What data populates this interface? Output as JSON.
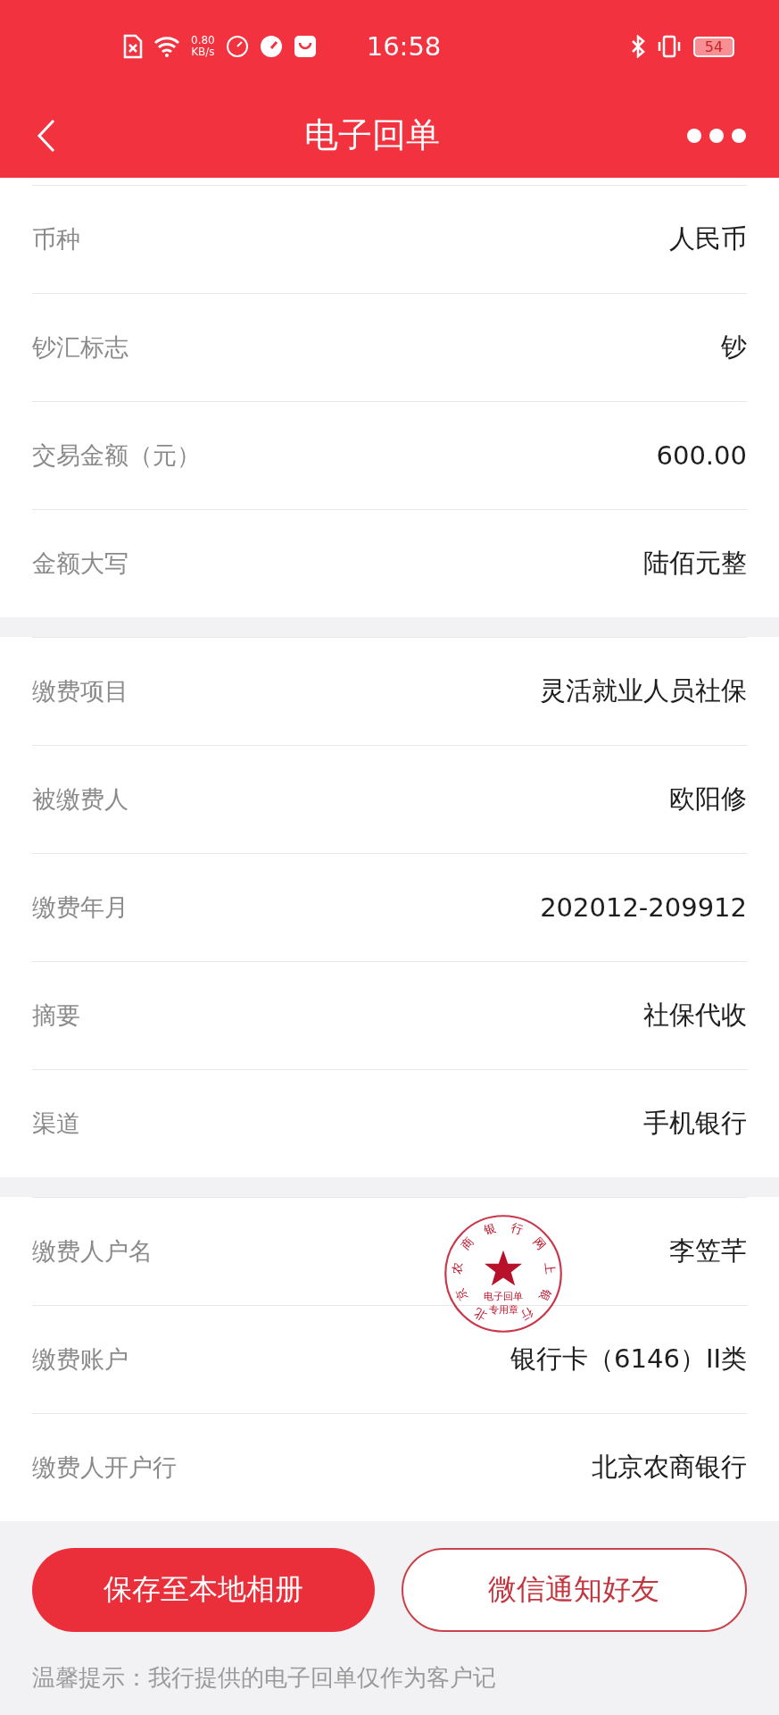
{
  "status_bar": {
    "net_speed_value": "0.80",
    "net_speed_unit": "KB/s",
    "time": "16:58",
    "battery": "54"
  },
  "header": {
    "title": "电子回单"
  },
  "sections": [
    {
      "rows": [
        {
          "label": "币种",
          "value": "人民币"
        },
        {
          "label": "钞汇标志",
          "value": "钞"
        },
        {
          "label": "交易金额（元）",
          "value": "600.00"
        },
        {
          "label": "金额大写",
          "value": "陆佰元整"
        }
      ]
    },
    {
      "rows": [
        {
          "label": "缴费项目",
          "value": "灵活就业人员社保"
        },
        {
          "label": "被缴费人",
          "value": "欧阳修"
        },
        {
          "label": "缴费年月",
          "value": "202012-209912"
        },
        {
          "label": "摘要",
          "value": "社保代收"
        },
        {
          "label": "渠道",
          "value": "手机银行"
        }
      ]
    },
    {
      "rows": [
        {
          "label": "缴费人户名",
          "value": "李笠芊"
        },
        {
          "label": "缴费账户",
          "value": "银行卡（6146）II类"
        },
        {
          "label": "缴费人开户行",
          "value": "北京农商银行"
        }
      ],
      "stamp": {
        "ring_text": "北京农商银行网上银行",
        "line_1": "电子回单",
        "line_2": "专用章"
      }
    }
  ],
  "buttons": [
    {
      "label": "保存至本地相册",
      "kind": "primary"
    },
    {
      "label": "微信通知好友",
      "kind": "outline"
    }
  ],
  "footer_note": "温馨提示：我行提供的电子回单仅作为客户记"
}
